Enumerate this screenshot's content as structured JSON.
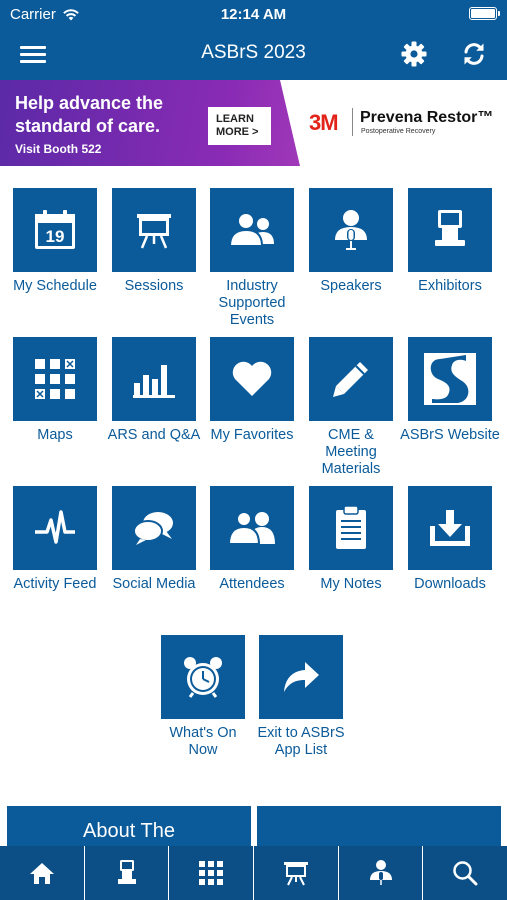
{
  "status_bar": {
    "carrier": "Carrier",
    "time": "12:14 AM"
  },
  "nav": {
    "title": "ASBrS 2023"
  },
  "ad": {
    "headline": "Help advance the standard of care.",
    "booth": "Visit Booth 522",
    "cta": "LEARN MORE >",
    "brand": "3M",
    "product": "Prevena Restor™",
    "product_sub": "Postoperative Recovery"
  },
  "tiles": [
    {
      "label": "My Schedule",
      "calendar_day": "19"
    },
    {
      "label": "Sessions"
    },
    {
      "label": "Industry Supported Events"
    },
    {
      "label": "Speakers"
    },
    {
      "label": "Exhibitors"
    },
    {
      "label": "Maps"
    },
    {
      "label": "ARS and Q&A"
    },
    {
      "label": "My Favorites"
    },
    {
      "label": "CME & Meeting Materials"
    },
    {
      "label": "ASBrS Website"
    },
    {
      "label": "Activity Feed"
    },
    {
      "label": "Social Media"
    },
    {
      "label": "Attendees"
    },
    {
      "label": "My Notes"
    },
    {
      "label": "Downloads"
    },
    {
      "label": "What's On Now"
    },
    {
      "label": "Exit to ASBrS App List"
    }
  ],
  "cards": {
    "about": "About The"
  },
  "colors": {
    "primary": "#0b5b9a",
    "tab_bar": "#0b4f86",
    "ad_purple": "#7a2ab0",
    "brand_red": "#e2231a"
  },
  "tab_bar_icons": [
    "home-icon",
    "exhibitor-kiosk-icon",
    "map-grid-icon",
    "sessions-easel-icon",
    "speaker-icon",
    "search-icon"
  ]
}
